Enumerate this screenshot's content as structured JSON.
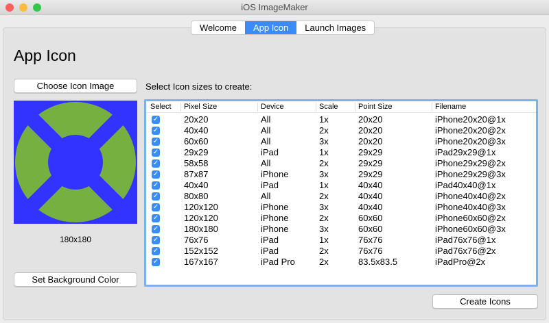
{
  "window": {
    "title": "iOS ImageMaker"
  },
  "tabs": [
    {
      "label": "Welcome"
    },
    {
      "label": "App Icon"
    },
    {
      "label": "Launch Images"
    }
  ],
  "page": {
    "title": "App Icon",
    "choose_button": "Choose Icon Image",
    "icon_size": "180x180",
    "bg_button": "Set Background Color",
    "instructions": "Select Icon sizes to create:",
    "create_button": "Create Icons"
  },
  "colors": {
    "icon_bg": "#3333ff",
    "icon_fg": "#76b041",
    "accent": "#3b8bf8"
  },
  "table": {
    "headers": [
      "Select",
      "Pixel Size",
      "Device",
      "Scale",
      "Point Size",
      "Filename"
    ],
    "rows": [
      {
        "checked": true,
        "pixel": "20x20",
        "device": "All",
        "scale": "1x",
        "point": "20x20",
        "file": "iPhone20x20@1x"
      },
      {
        "checked": true,
        "pixel": "40x40",
        "device": "All",
        "scale": "2x",
        "point": "20x20",
        "file": "iPhone20x20@2x"
      },
      {
        "checked": true,
        "pixel": "60x60",
        "device": "All",
        "scale": "3x",
        "point": "20x20",
        "file": "iPhone20x20@3x"
      },
      {
        "checked": true,
        "pixel": "29x29",
        "device": "iPad",
        "scale": "1x",
        "point": "29x29",
        "file": "iPad29x29@1x"
      },
      {
        "checked": true,
        "pixel": "58x58",
        "device": "All",
        "scale": "2x",
        "point": "29x29",
        "file": "iPhone29x29@2x"
      },
      {
        "checked": true,
        "pixel": "87x87",
        "device": "iPhone",
        "scale": "3x",
        "point": "29x29",
        "file": "iPhone29x29@3x"
      },
      {
        "checked": true,
        "pixel": "40x40",
        "device": "iPad",
        "scale": "1x",
        "point": "40x40",
        "file": "iPad40x40@1x"
      },
      {
        "checked": true,
        "pixel": "80x80",
        "device": "All",
        "scale": "2x",
        "point": "40x40",
        "file": "iPhone40x40@2x"
      },
      {
        "checked": true,
        "pixel": "120x120",
        "device": "iPhone",
        "scale": "3x",
        "point": "40x40",
        "file": "iPhone40x40@3x"
      },
      {
        "checked": true,
        "pixel": "120x120",
        "device": "iPhone",
        "scale": "2x",
        "point": "60x60",
        "file": "iPhone60x60@2x"
      },
      {
        "checked": true,
        "pixel": "180x180",
        "device": "iPhone",
        "scale": "3x",
        "point": "60x60",
        "file": "iPhone60x60@3x"
      },
      {
        "checked": true,
        "pixel": "76x76",
        "device": "iPad",
        "scale": "1x",
        "point": "76x76",
        "file": "iPad76x76@1x"
      },
      {
        "checked": true,
        "pixel": "152x152",
        "device": "iPad",
        "scale": "2x",
        "point": "76x76",
        "file": "iPad76x76@2x"
      },
      {
        "checked": true,
        "pixel": "167x167",
        "device": "iPad Pro",
        "scale": "2x",
        "point": "83.5x83.5",
        "file": "iPadPro@2x"
      }
    ]
  }
}
